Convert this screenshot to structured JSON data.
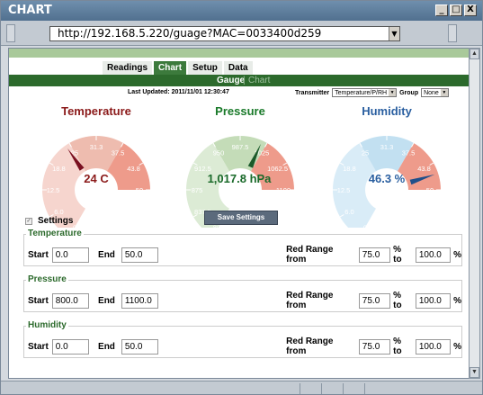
{
  "window": {
    "title": "CHART",
    "minimize": "_",
    "maximize": "□",
    "close": "X"
  },
  "address": {
    "url": "http://192.168.5.220/guage?MAC=0033400d259",
    "dropdown": "▼"
  },
  "nav": {
    "tabs": [
      {
        "label": "Readings"
      },
      {
        "label": "Chart"
      },
      {
        "label": "Setup"
      },
      {
        "label": "Data"
      }
    ],
    "subnav_active": "Gauge",
    "subnav_sep": "|",
    "subnav_other": "Chart"
  },
  "status": {
    "last_updated": "Last Updated: 2011/11/01 12:30:47",
    "transmitter_label": "Transmitter",
    "transmitter_value": "Temperature/P/RH",
    "group_label": "Group",
    "group_value": "None"
  },
  "gauges": [
    {
      "title": "Temperature",
      "value_text": "24 C",
      "value": 24,
      "ticks": [
        "0",
        "6.0",
        "12.5",
        "18.8",
        "25",
        "31.3",
        "37.5",
        "43.8",
        "50"
      ],
      "min": 0,
      "max": 50,
      "red_from_pct": 75,
      "title_color": "#8b1a1a",
      "text_color": "#8b1a1a",
      "needle_color": "#7a1020",
      "band_light": "#f6d5ce",
      "band_mid": "#eebcaf",
      "band_red": "#ee9b8b",
      "tick_color": "#ffffff"
    },
    {
      "title": "Pressure",
      "value_text": "1,017.8 hPa",
      "value": 1017.8,
      "ticks": [
        "800",
        "837.5",
        "875",
        "912.5",
        "950",
        "987.5",
        "1025",
        "1062.5",
        "1100"
      ],
      "min": 800,
      "max": 1100,
      "red_from_pct": 75,
      "title_color": "#1a7a2a",
      "text_color": "#1a6a2a",
      "needle_color": "#1a5a2a",
      "band_light": "#dcebd5",
      "band_mid": "#c4dcb8",
      "band_red": "#ee9b8b",
      "tick_color": "#ffffff"
    },
    {
      "title": "Humidity",
      "value_text": "46.3 %",
      "value": 46.3,
      "ticks": [
        "0",
        "6.0",
        "12.5",
        "18.8",
        "25",
        "31.3",
        "37.5",
        "43.8",
        "50"
      ],
      "min": 0,
      "max": 50,
      "red_from_pct": 75,
      "title_color": "#2a5fa0",
      "text_color": "#2a5fa0",
      "needle_color": "#1f4f8a",
      "band_light": "#d9ecf7",
      "band_mid": "#c2e0f1",
      "band_red": "#ee9b8b",
      "tick_color": "#ffffff"
    }
  ],
  "settings": {
    "save_label": "Save Settings",
    "label": "Settings",
    "start_label": "Start",
    "end_label": "End",
    "red_range_label": "Red Range from",
    "percent_to": "% to",
    "percent": "%",
    "groups": [
      {
        "legend": "Temperature",
        "start": "0.0",
        "end": "50.0",
        "red_from": "75.0",
        "red_to": "100.0"
      },
      {
        "legend": "Pressure",
        "start": "800.0",
        "end": "1100.0",
        "red_from": "75.0",
        "red_to": "100.0"
      },
      {
        "legend": "Humidity",
        "start": "0.0",
        "end": "50.0",
        "red_from": "75.0",
        "red_to": "100.0"
      }
    ]
  }
}
